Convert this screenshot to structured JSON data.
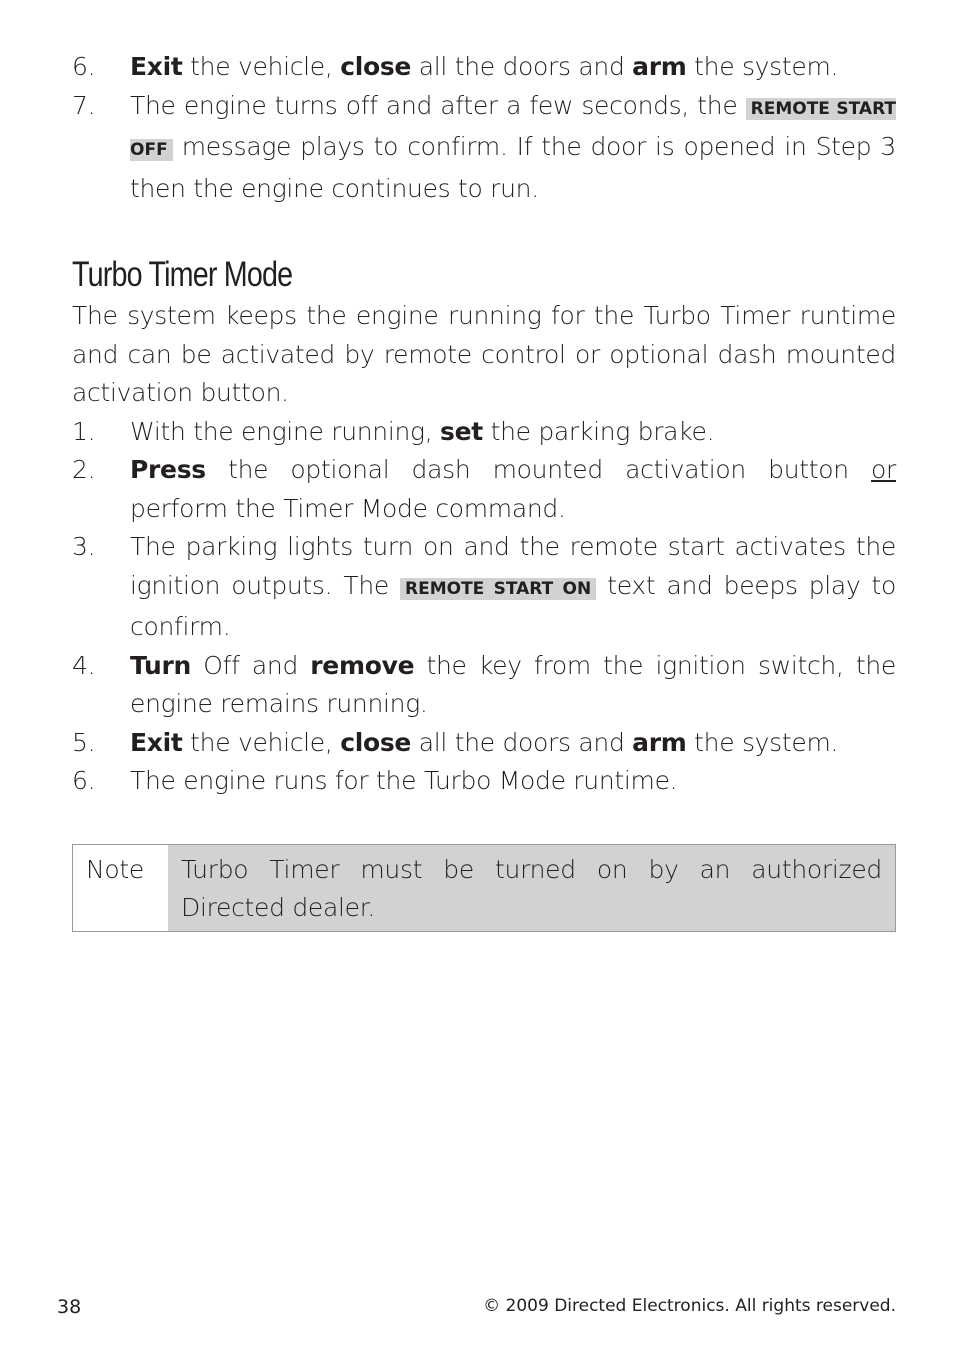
{
  "top_list": [
    {
      "num": "6.",
      "parts": [
        {
          "b": "Exit"
        },
        {
          "t": " the vehicle, "
        },
        {
          "b": "close"
        },
        {
          "t": " all the doors and "
        },
        {
          "b": "arm"
        },
        {
          "t": " the system."
        }
      ]
    },
    {
      "num": "7.",
      "parts": [
        {
          "t": "The engine turns off and after a few seconds, the "
        },
        {
          "tag": "REMOTE START OFF"
        },
        {
          "t": " message plays to confirm. If the door is opened in Step 3 then the engine continues to run."
        }
      ]
    }
  ],
  "section": {
    "title": "Turbo Timer Mode",
    "intro": "The system keeps the engine running for the Turbo Timer runtime and can be activated by remote control or optional dash mounted activation button.",
    "steps": [
      {
        "num": "1.",
        "parts": [
          {
            "t": "With the engine running, "
          },
          {
            "b": "set"
          },
          {
            "t": " the parking brake."
          }
        ]
      },
      {
        "num": "2.",
        "parts": [
          {
            "b": "Press"
          },
          {
            "t": " the optional dash mounted activation button "
          },
          {
            "u": "or"
          },
          {
            "t": " perform the Timer Mode command."
          }
        ]
      },
      {
        "num": "3.",
        "parts": [
          {
            "t": "The parking lights turn on and the remote start activates the ignition outputs. The "
          },
          {
            "tag": "REMOTE START ON"
          },
          {
            "t": " text and beeps play to confirm."
          }
        ]
      },
      {
        "num": "4.",
        "parts": [
          {
            "b": "Turn"
          },
          {
            "t": " Off and "
          },
          {
            "b": "remove"
          },
          {
            "t": " the key from the ignition switch, the engine remains running."
          }
        ]
      },
      {
        "num": "5.",
        "parts": [
          {
            "b": "Exit"
          },
          {
            "t": " the vehicle, "
          },
          {
            "b": "close"
          },
          {
            "t": " all the doors and "
          },
          {
            "b": "arm"
          },
          {
            "t": " the system."
          }
        ]
      },
      {
        "num": "6.",
        "parts": [
          {
            "t": "The engine runs for the Turbo Mode runtime."
          }
        ]
      }
    ]
  },
  "note": {
    "label": "Note",
    "text": "Turbo Timer must be turned on by an authorized Directed dealer."
  },
  "footer": {
    "page_number": "38",
    "copyright": "© 2009 Directed Electronics. All rights reserved."
  }
}
